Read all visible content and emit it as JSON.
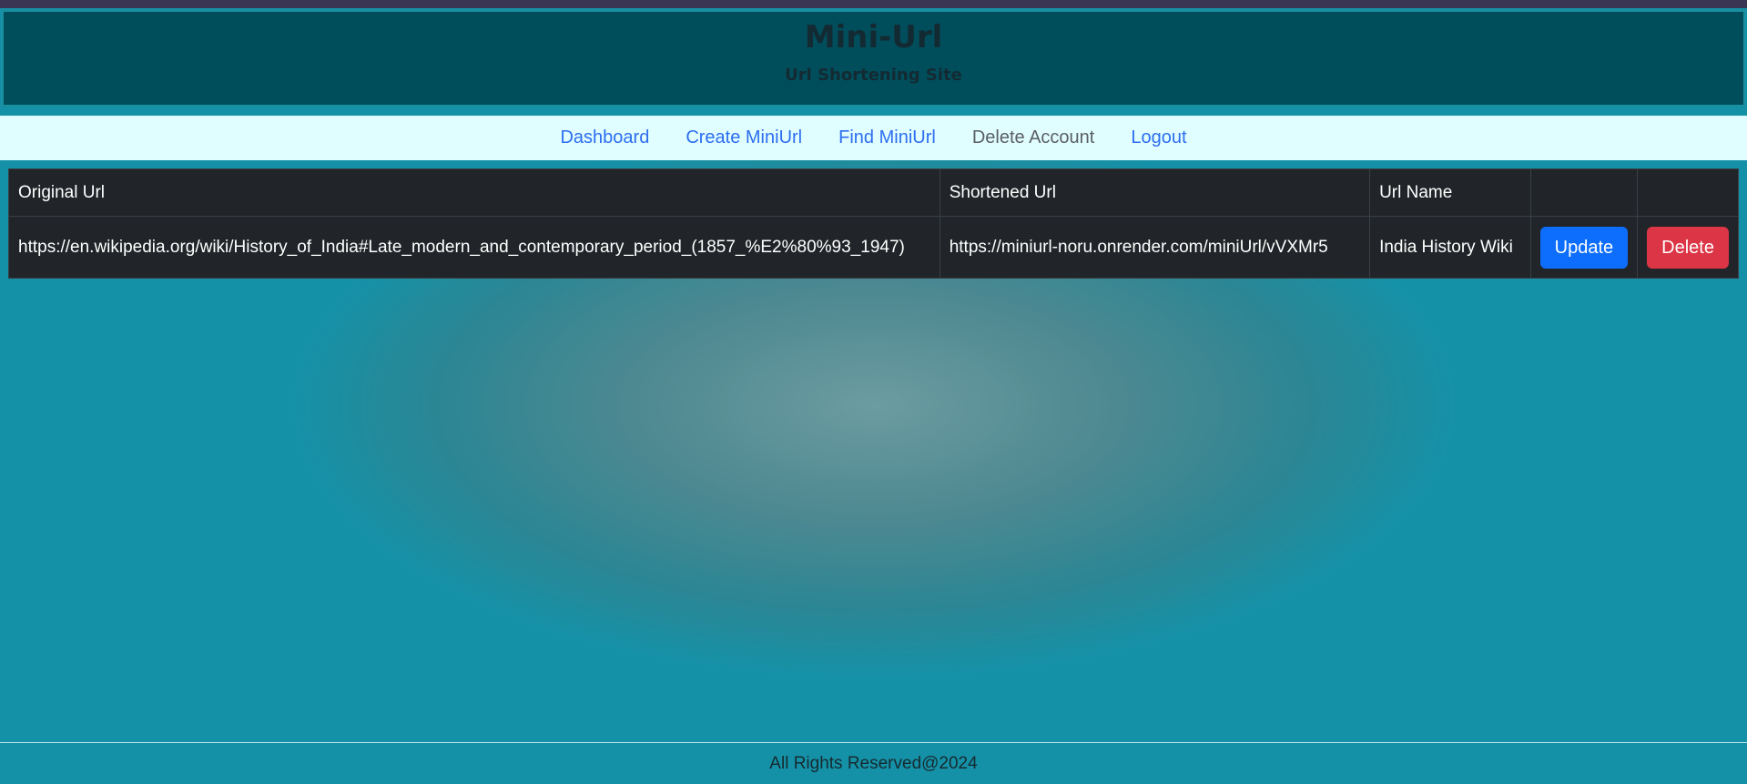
{
  "header": {
    "title": "Mini-Url",
    "subtitle": "Url Shortening Site"
  },
  "nav": {
    "items": [
      {
        "label": "Dashboard"
      },
      {
        "label": "Create MiniUrl"
      },
      {
        "label": "Find MiniUrl"
      },
      {
        "label": "Delete Account"
      },
      {
        "label": "Logout"
      }
    ]
  },
  "table": {
    "headers": [
      "Original Url",
      "Shortened Url",
      "Url Name",
      "",
      ""
    ],
    "rows": [
      {
        "original_url": "https://en.wikipedia.org/wiki/History_of_India#Late_modern_and_contemporary_period_(1857_%E2%80%93_1947)",
        "shortened_url": "https://miniurl-noru.onrender.com/miniUrl/vVXMr5",
        "url_name": "India History Wiki",
        "update_label": "Update",
        "delete_label": "Delete"
      }
    ]
  },
  "footer": {
    "text": "All Rights Reserved@2024"
  },
  "colors": {
    "header_bg": "#004e5b",
    "nav_bg": "#e0fdff",
    "link": "#2d6ef0",
    "table_bg": "#212529",
    "update_button": "#0d6efd",
    "delete_button": "#dc3545",
    "page_bg": "#1591a7"
  }
}
